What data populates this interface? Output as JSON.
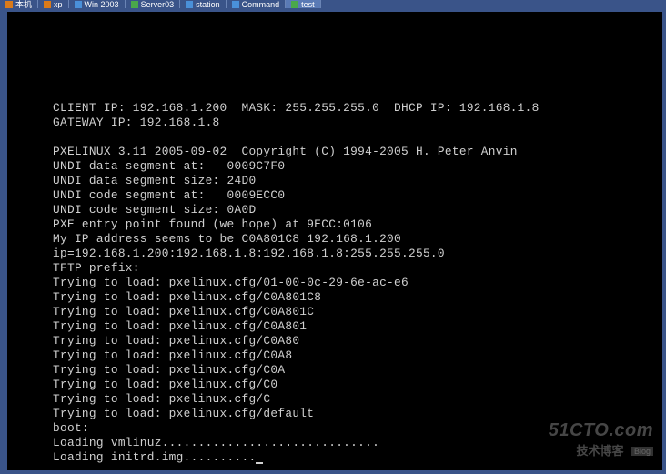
{
  "tabs": [
    {
      "label": "本机",
      "icon": "orange"
    },
    {
      "label": "xp",
      "icon": "orange"
    },
    {
      "label": "Win 2003",
      "icon": "blue"
    },
    {
      "label": "Server03",
      "icon": "green"
    },
    {
      "label": "station",
      "icon": "blue"
    },
    {
      "label": "Command",
      "icon": "blue"
    },
    {
      "label": "test",
      "icon": "green",
      "active": true
    }
  ],
  "terminal": {
    "lines": [
      "CLIENT IP: 192.168.1.200  MASK: 255.255.255.0  DHCP IP: 192.168.1.8",
      "GATEWAY IP: 192.168.1.8",
      "",
      "PXELINUX 3.11 2005-09-02  Copyright (C) 1994-2005 H. Peter Anvin",
      "UNDI data segment at:   0009C7F0",
      "UNDI data segment size: 24D0",
      "UNDI code segment at:   0009ECC0",
      "UNDI code segment size: 0A0D",
      "PXE entry point found (we hope) at 9ECC:0106",
      "My IP address seems to be C0A801C8 192.168.1.200",
      "ip=192.168.1.200:192.168.1.8:192.168.1.8:255.255.255.0",
      "TFTP prefix:",
      "Trying to load: pxelinux.cfg/01-00-0c-29-6e-ac-e6",
      "Trying to load: pxelinux.cfg/C0A801C8",
      "Trying to load: pxelinux.cfg/C0A801C",
      "Trying to load: pxelinux.cfg/C0A801",
      "Trying to load: pxelinux.cfg/C0A80",
      "Trying to load: pxelinux.cfg/C0A8",
      "Trying to load: pxelinux.cfg/C0A",
      "Trying to load: pxelinux.cfg/C0",
      "Trying to load: pxelinux.cfg/C",
      "Trying to load: pxelinux.cfg/default",
      "boot:",
      "Loading vmlinuz..............................",
      "Loading initrd.img.........."
    ]
  },
  "watermark": {
    "line1": "51CTO.com",
    "line2": "技术博客",
    "tag": "Blog"
  }
}
